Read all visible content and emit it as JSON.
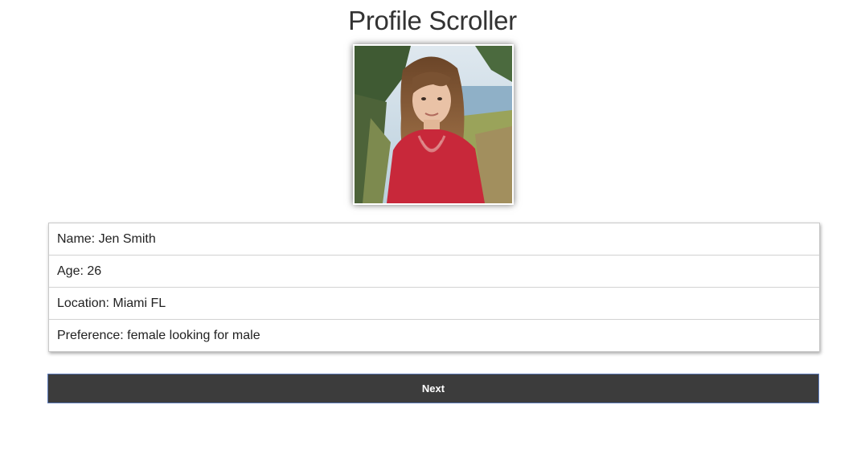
{
  "header": {
    "title": "Profile Scroller"
  },
  "profile": {
    "photo_alt": "profile-photo",
    "rows": [
      {
        "label": "Name:",
        "value": "Jen Smith"
      },
      {
        "label": "Age:",
        "value": "26"
      },
      {
        "label": "Location:",
        "value": "Miami FL"
      },
      {
        "label": "Preference:",
        "value": "female looking for male"
      }
    ]
  },
  "actions": {
    "next_label": "Next"
  },
  "colors": {
    "button_bg": "#3c3c3c",
    "button_border": "#5b79b7",
    "title_text": "#333333"
  }
}
